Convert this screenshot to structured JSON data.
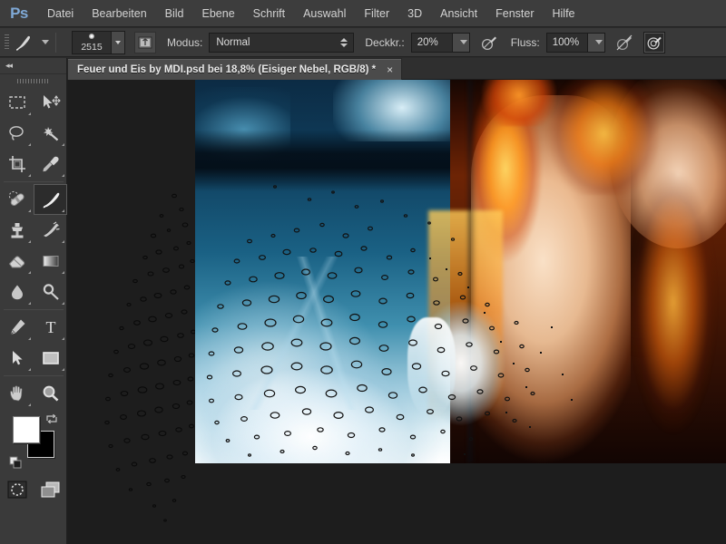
{
  "app": {
    "name": "Adobe Photoshop",
    "logo_text": "Ps",
    "logo_color": "#7fa9d6"
  },
  "menubar": {
    "items": [
      {
        "label": "Datei"
      },
      {
        "label": "Bearbeiten"
      },
      {
        "label": "Bild"
      },
      {
        "label": "Ebene"
      },
      {
        "label": "Schrift"
      },
      {
        "label": "Auswahl"
      },
      {
        "label": "Filter"
      },
      {
        "label": "3D"
      },
      {
        "label": "Ansicht"
      },
      {
        "label": "Fenster"
      },
      {
        "label": "Hilfe"
      }
    ]
  },
  "options_bar": {
    "tool": "brush-tool",
    "brush_preset_icon": "brush-tip-icon",
    "brush_size": "2515",
    "tablet_pressure_icon": "tablet-pressure-icon",
    "mode_label": "Modus:",
    "mode_value": "Normal",
    "opacity_label": "Deckkr.:",
    "opacity_value": "20%",
    "opacity_pressure_icon": "pressure-opacity-icon",
    "flow_label": "Fluss:",
    "flow_value": "100%",
    "flow_pressure_icon": "pressure-flow-icon",
    "airbrush_icon": "airbrush-icon",
    "airbrush_active": true
  },
  "tabs": {
    "active": {
      "title": "Feuer und Eis by MDI.psd bei 18,8% (Eisiger Nebel, RGB/8) *",
      "close_label": "×"
    }
  },
  "toolbox": {
    "collapse_label": "◂◂",
    "groups": [
      {
        "tools": [
          {
            "name": "rectangular-marquee-tool",
            "icon": "marquee-icon",
            "has_flyout": true,
            "selected": false
          },
          {
            "name": "move-tool",
            "icon": "move-icon",
            "has_flyout": false,
            "selected": false
          },
          {
            "name": "lasso-tool",
            "icon": "lasso-icon",
            "has_flyout": true,
            "selected": false
          },
          {
            "name": "magic-wand-tool",
            "icon": "magic-wand-icon",
            "has_flyout": true,
            "selected": false
          },
          {
            "name": "crop-tool",
            "icon": "crop-icon",
            "has_flyout": true,
            "selected": false
          },
          {
            "name": "eyedropper-tool",
            "icon": "eyedropper-icon",
            "has_flyout": true,
            "selected": false
          }
        ]
      },
      {
        "tools": [
          {
            "name": "spot-healing-brush-tool",
            "icon": "healing-bandage-icon",
            "has_flyout": true,
            "selected": false
          },
          {
            "name": "brush-tool",
            "icon": "brush-icon",
            "has_flyout": true,
            "selected": true
          },
          {
            "name": "clone-stamp-tool",
            "icon": "clone-stamp-icon",
            "has_flyout": true,
            "selected": false
          },
          {
            "name": "history-brush-tool",
            "icon": "history-brush-icon",
            "has_flyout": true,
            "selected": false
          },
          {
            "name": "eraser-tool",
            "icon": "eraser-icon",
            "has_flyout": true,
            "selected": false
          },
          {
            "name": "gradient-tool",
            "icon": "gradient-icon",
            "has_flyout": true,
            "selected": false
          },
          {
            "name": "blur-tool",
            "icon": "blur-drop-icon",
            "has_flyout": true,
            "selected": false
          },
          {
            "name": "dodge-tool",
            "icon": "dodge-icon",
            "has_flyout": true,
            "selected": false
          }
        ]
      },
      {
        "tools": [
          {
            "name": "pen-tool",
            "icon": "pen-icon",
            "has_flyout": true,
            "selected": false
          },
          {
            "name": "type-tool",
            "icon": "type-T-icon",
            "has_flyout": true,
            "selected": false
          },
          {
            "name": "path-selection-tool",
            "icon": "path-arrow-icon",
            "has_flyout": true,
            "selected": false
          },
          {
            "name": "rectangle-shape-tool",
            "icon": "rectangle-shape-icon",
            "has_flyout": true,
            "selected": false
          }
        ]
      },
      {
        "tools": [
          {
            "name": "hand-tool",
            "icon": "hand-icon",
            "has_flyout": true,
            "selected": false
          },
          {
            "name": "zoom-tool",
            "icon": "magnifier-icon",
            "has_flyout": false,
            "selected": false
          }
        ]
      }
    ],
    "colors": {
      "foreground": "#ffffff",
      "background": "#000000",
      "swap_icon": "swap-colors-icon",
      "default_icon": "default-colors-icon"
    },
    "modes": [
      {
        "name": "quick-mask-mode-button",
        "icon": "quick-mask-icon"
      },
      {
        "name": "screen-mode-button",
        "icon": "screen-mode-icon",
        "has_flyout": true
      }
    ]
  },
  "canvas": {
    "document_background": "#1d1d1d",
    "zoom_level": "18,8%",
    "layer_name": "Eisiger Nebel",
    "color_mode": "RGB/8",
    "selection_active": true,
    "selection_description": "marching-ants speckle selection from airbrush dissolve",
    "palette": {
      "ice_deep": "#0c2b44",
      "ice_mid": "#1a6184",
      "ice_light": "#e8f4f8",
      "fire_orange": "#f98114",
      "fire_yellow": "#ffd660",
      "flesh": "#ffe7cd",
      "shadow": "#160703"
    }
  }
}
